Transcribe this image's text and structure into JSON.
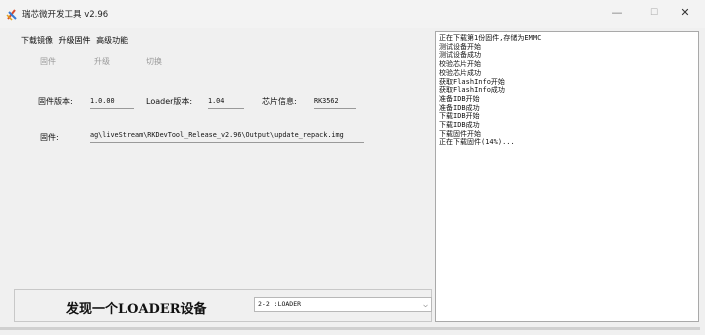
{
  "window": {
    "title": "瑞芯微开发工具 v2.96",
    "min_icon": "minimize-icon",
    "max_icon": "maximize-icon",
    "close_icon": "close-icon"
  },
  "tabs": [
    {
      "label": "下载镜像"
    },
    {
      "label": "升级固件"
    },
    {
      "label": "高级功能"
    }
  ],
  "actions": {
    "firmware_label": "固件",
    "upgrade_label": "升级",
    "switch_label": "切换"
  },
  "info": {
    "fw_version_label": "固件版本:",
    "fw_version_value": "1.0.00",
    "loader_version_label": "Loader版本:",
    "loader_version_value": "1.04",
    "chip_label": "芯片信息:",
    "chip_value": "RK3562",
    "firmware_path_label": "固件:",
    "firmware_path_value": "ag\\liveStream\\RKDevTool_Release_v2.96\\Output\\update_repack.img"
  },
  "status": {
    "text": "发现一个LOADER设备"
  },
  "device_select": {
    "value": "2-2 :LOADER"
  },
  "log": {
    "lines": [
      "正在下载第1份固件,存储为EMMC",
      "测试设备开始",
      "测试设备成功",
      "校验芯片开始",
      "校验芯片成功",
      "获取FlashInfo开始",
      "获取FlashInfo成功",
      "准备IDB开始",
      "准备IDB成功",
      "下载IDB开始",
      "下载IDB成功",
      "下载固件开始",
      "正在下载固件(14%)..."
    ]
  }
}
